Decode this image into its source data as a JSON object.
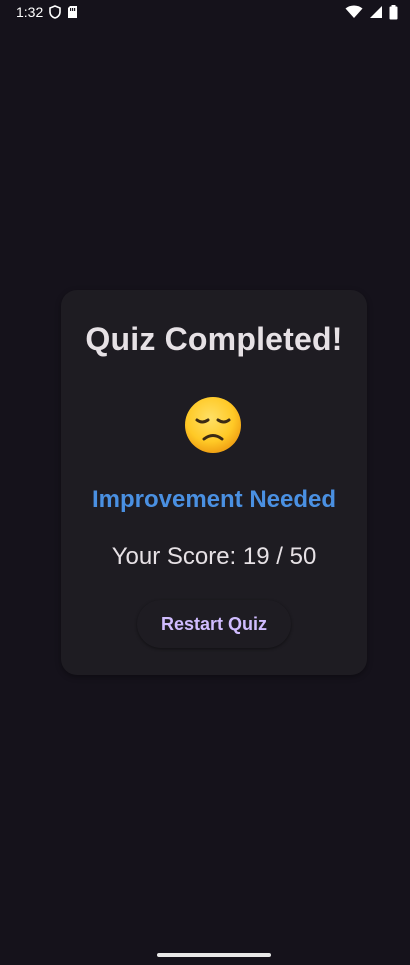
{
  "status_bar": {
    "time": "1:32"
  },
  "card": {
    "title": "Quiz Completed!",
    "emoji": "disappointed-face",
    "result_label": "Improvement Needed",
    "score_text": "Your Score: 19 / 50",
    "restart_label": "Restart Quiz"
  },
  "colors": {
    "background": "#15121b",
    "card": "#1e1c22",
    "result_label": "#4a90e2",
    "button_text": "#d0bcff",
    "text": "#e6e1e5"
  }
}
